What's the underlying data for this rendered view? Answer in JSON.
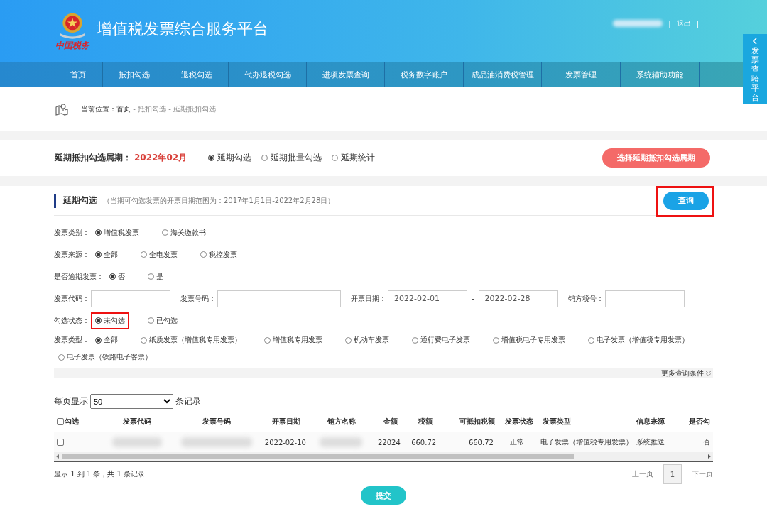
{
  "header": {
    "logo_text": "中国税务",
    "title": "增值税发票综合服务平台",
    "user_blurred": true,
    "separator_left": "|",
    "logout": "退出",
    "separator_right": "|"
  },
  "side_tab": {
    "text": "发票查验平台"
  },
  "nav": [
    {
      "label": "首页"
    },
    {
      "label": "抵扣勾选"
    },
    {
      "label": "退税勾选"
    },
    {
      "label": "代办退税勾选"
    },
    {
      "label": "进项发票查询"
    },
    {
      "label": "税务数字账户"
    },
    {
      "label": "成品油消费税管理"
    },
    {
      "label": "发票管理"
    },
    {
      "label": "系统辅助功能"
    }
  ],
  "breadcrumb": {
    "label": "当前位置：",
    "items": [
      "首页",
      "- 抵扣勾选",
      "- 延期抵扣勾选"
    ]
  },
  "period": {
    "label": "延期抵扣勾选属期：",
    "value": "2022年02月",
    "modes": [
      {
        "label": "延期勾选",
        "selected": true
      },
      {
        "label": "延期批量勾选",
        "selected": false
      },
      {
        "label": "延期统计",
        "selected": false
      }
    ],
    "button": "选择延期抵扣勾选属期"
  },
  "section": {
    "title": "延期勾选",
    "note": "（当期可勾选发票的开票日期范围为：2017年1月1日-2022年2月28日）",
    "query_button": {
      "label": "查询",
      "highlighted": true
    }
  },
  "filters": [
    {
      "kind": "radio",
      "label": "发票类别：",
      "options": [
        {
          "label": "增值税发票",
          "selected": true,
          "highlighted": false
        },
        {
          "label": "海关缴款书",
          "selected": false,
          "highlighted": false
        }
      ]
    },
    {
      "kind": "radio",
      "label": "发票来源：",
      "options": [
        {
          "label": "全部",
          "selected": true,
          "highlighted": false
        },
        {
          "label": "全电发票",
          "selected": false,
          "highlighted": false
        },
        {
          "label": "税控发票",
          "selected": false,
          "highlighted": false
        }
      ]
    },
    {
      "kind": "radio",
      "label": "是否逾期发票：",
      "options": [
        {
          "label": "否",
          "selected": true,
          "highlighted": false
        },
        {
          "label": "是",
          "selected": false,
          "highlighted": false
        }
      ]
    },
    {
      "kind": "fields",
      "fields": [
        {
          "label": "发票代码："
        },
        {
          "label": "发票号码："
        },
        {
          "label": "开票日期：",
          "value": "2022-02-01",
          "separator": "-",
          "value_to": "2022-02-28"
        },
        {
          "label": "销方税号："
        }
      ]
    },
    {
      "kind": "radio",
      "label": "勾选状态：",
      "options": [
        {
          "label": "未勾选",
          "selected": true,
          "highlighted": true
        },
        {
          "label": "已勾选",
          "selected": false,
          "highlighted": false
        }
      ]
    },
    {
      "kind": "radio",
      "label": "发票类型：",
      "options": [
        {
          "label": "全部",
          "selected": true,
          "highlighted": false
        },
        {
          "label": "纸质发票（增值税专用发票）",
          "selected": false,
          "highlighted": false
        },
        {
          "label": "增值税专用发票",
          "selected": false,
          "highlighted": false
        },
        {
          "label": "机动车发票",
          "selected": false,
          "highlighted": false
        },
        {
          "label": "通行费电子发票",
          "selected": false,
          "highlighted": false
        },
        {
          "label": "增值税电子专用发票",
          "selected": false,
          "highlighted": false
        },
        {
          "label": "电子发票（增值税专用发票）",
          "selected": false,
          "highlighted": false
        },
        {
          "label": "电子发票（铁路电子客票）",
          "selected": false,
          "highlighted": false
        }
      ]
    }
  ],
  "more_conditions": "更多查询条件",
  "page_size": {
    "label_before": "每页显示",
    "value": "50",
    "label_after": "条记录"
  },
  "table": {
    "columns": [
      "勾选",
      "发票代码",
      "发票号码",
      "开票日期",
      "销方名称",
      "金额",
      "税额",
      "可抵扣税额",
      "发票状态",
      "发票类型",
      "信息来源",
      "是否勾"
    ],
    "rows": [
      {
        "cells": [
          {
            "kind": "checkbox",
            "checked": false
          },
          {
            "kind": "blurred"
          },
          {
            "kind": "blurred"
          },
          {
            "kind": "text",
            "text": "2022-02-10"
          },
          {
            "kind": "blurred"
          },
          {
            "kind": "text",
            "text": "22024"
          },
          {
            "kind": "text",
            "text": "660.72"
          },
          {
            "kind": "text",
            "text": "660.72"
          },
          {
            "kind": "text",
            "text": "正常"
          },
          {
            "kind": "text",
            "text": "电子发票（增值税专用发票）"
          },
          {
            "kind": "text",
            "text": "系统推送"
          },
          {
            "kind": "text",
            "text": "否"
          }
        ]
      }
    ]
  },
  "summary": "显示 1 到 1 条，共 1 条记录",
  "pagination": {
    "prev": "上一页",
    "pages": [
      {
        "label": "1",
        "selected": true
      }
    ],
    "next": "下一页"
  },
  "submit": "提交"
}
